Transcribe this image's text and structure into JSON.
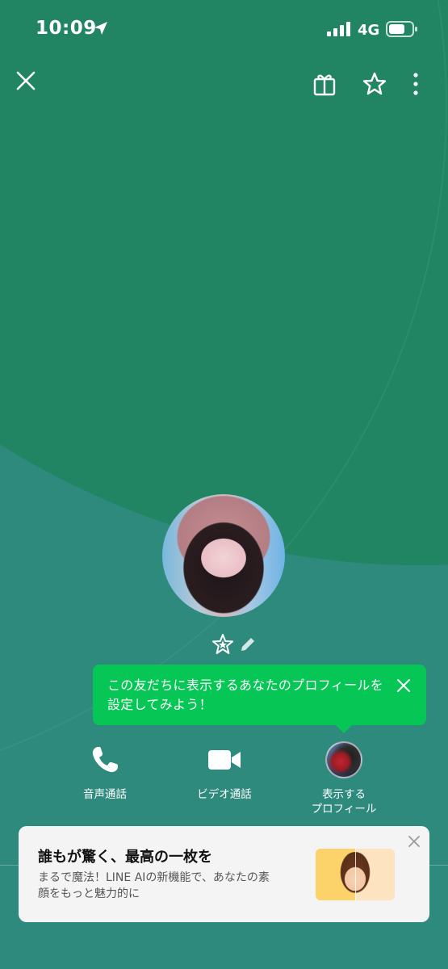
{
  "status_bar": {
    "time": "10:09",
    "network": "4G"
  },
  "top_bar": {
    "icons": [
      "close-icon",
      "gift-icon",
      "star-icon",
      "more-icon"
    ]
  },
  "profile": {
    "avatar_icon": "profile-photo",
    "badge_icon": "star-badge-icon",
    "edit_icon": "pencil-icon"
  },
  "tooltip": {
    "text": "この友だちに表示するあなたのプロフィールを設定してみよう！"
  },
  "actions": [
    {
      "label": "音声通話",
      "icon": "phone-icon"
    },
    {
      "label": "ビデオ通話",
      "icon": "video-camera-icon"
    },
    {
      "label": "表示する\nプロフィール",
      "icon": "profile-avatar"
    }
  ],
  "ad": {
    "title": "誰もが驚く、最高の一枚を",
    "description": "まるで魔法！LINE AIの新機能で、あなたの素顔をもっと魅力的に"
  },
  "colors": {
    "background": "#2f8a7e",
    "arc": "#218563",
    "tooltip": "#06c755"
  }
}
